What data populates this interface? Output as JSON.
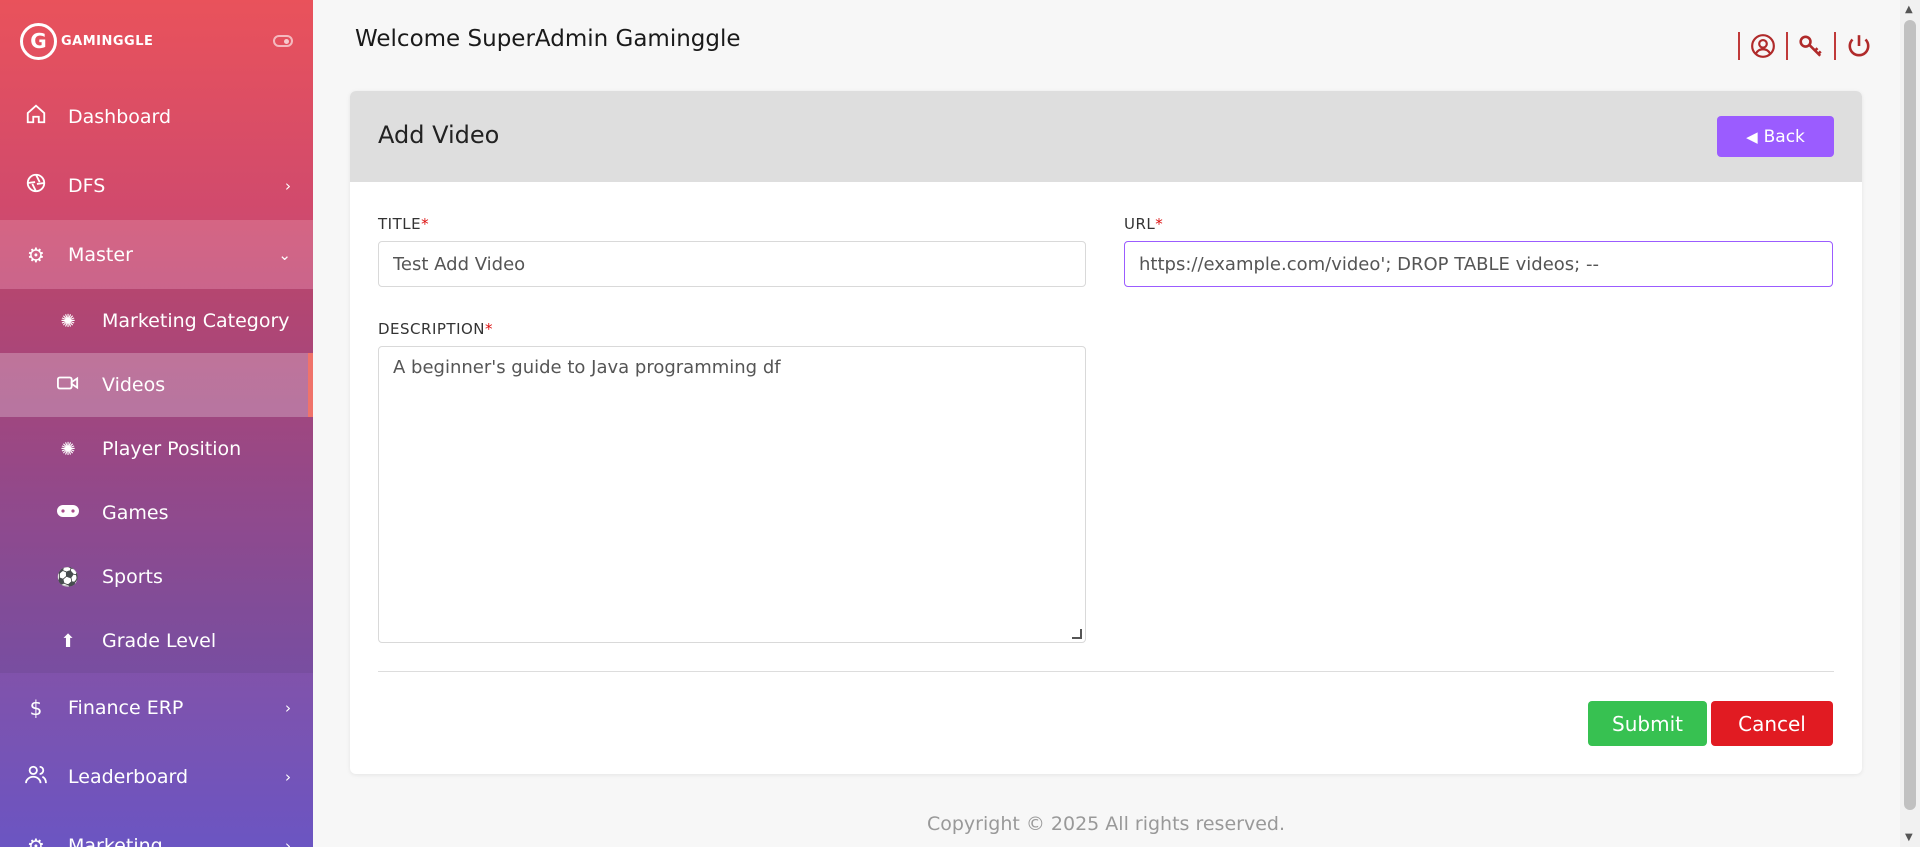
{
  "brand": {
    "name": "GAMINGGLE",
    "logo_letter": "G"
  },
  "sidebar": {
    "items": [
      {
        "label": "Dashboard",
        "icon": "home-icon"
      },
      {
        "label": "DFS",
        "icon": "aperture-icon"
      },
      {
        "label": "Master",
        "icon": "gears-icon"
      },
      {
        "label": "Finance ERP",
        "icon": "dollar-icon"
      },
      {
        "label": "Leaderboard",
        "icon": "users-icon"
      },
      {
        "label": "Marketing",
        "icon": "gears-icon"
      }
    ],
    "master_sub": [
      {
        "label": "Marketing Category",
        "icon": "badge-icon"
      },
      {
        "label": "Videos",
        "icon": "video-icon"
      },
      {
        "label": "Player Position",
        "icon": "badge-icon"
      },
      {
        "label": "Games",
        "icon": "gamepad-icon"
      },
      {
        "label": "Sports",
        "icon": "soccer-ball-icon"
      },
      {
        "label": "Grade Level",
        "icon": "arrow-up-icon"
      }
    ]
  },
  "header": {
    "welcome": "Welcome SuperAdmin Gaminggle"
  },
  "card": {
    "title": "Add Video",
    "back_label": "Back",
    "title_label": "TITLE",
    "title_value": "Test Add Video",
    "url_label": "URL",
    "url_value": "https://example.com/video'; DROP TABLE videos; --",
    "description_label": "DESCRIPTION",
    "description_value": "A beginner's guide to Java programming df",
    "required_mark": "*",
    "submit_label": "Submit",
    "cancel_label": "Cancel"
  },
  "footer": {
    "text": "Copyright © 2025  All rights reserved."
  },
  "colors": {
    "accent": "#9b5cff",
    "submit": "#37c151",
    "cancel": "#e11b22",
    "header_icons": "#b02a2a"
  }
}
